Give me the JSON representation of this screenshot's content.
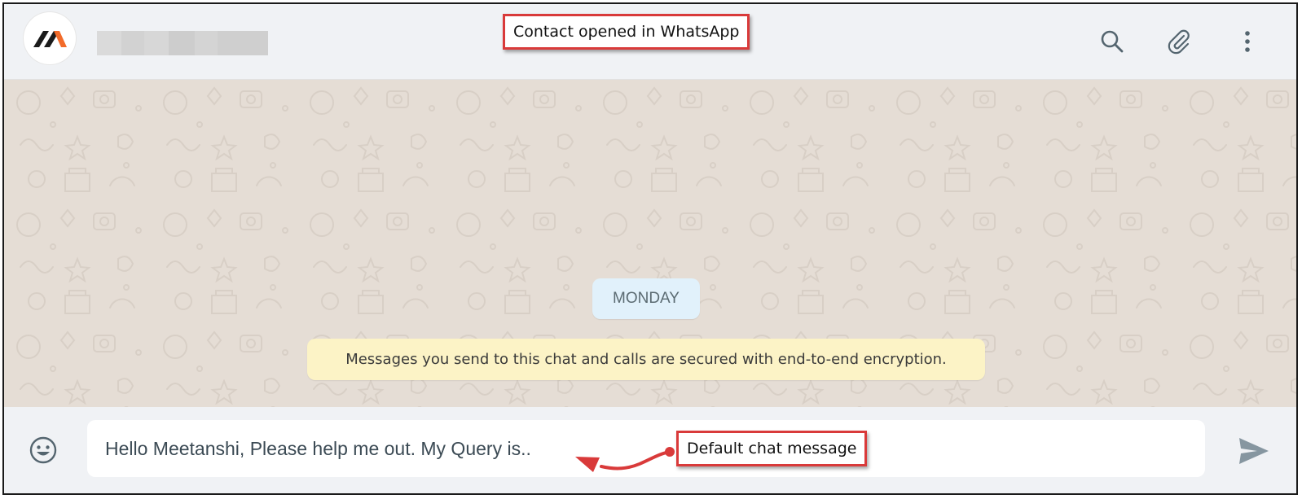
{
  "header": {
    "annotation": "Contact opened in WhatsApp",
    "icons": [
      "search-icon",
      "attach-icon",
      "menu-icon"
    ]
  },
  "chat": {
    "day_label": "MONDAY",
    "encryption_notice": "Messages you send to this chat and calls are secured with end-to-end encryption."
  },
  "composer": {
    "message_value": "Hello Meetanshi, Please help me out. My Query is..",
    "annotation": "Default chat message",
    "icons": [
      "emoji-icon",
      "send-icon"
    ]
  },
  "colors": {
    "annotation_border": "#d93a3a",
    "brand_orange": "#f26b2a",
    "day_badge_bg": "#e1f1fb",
    "notice_bg": "#fcf3c6",
    "chat_bg": "#e5ddd5"
  }
}
